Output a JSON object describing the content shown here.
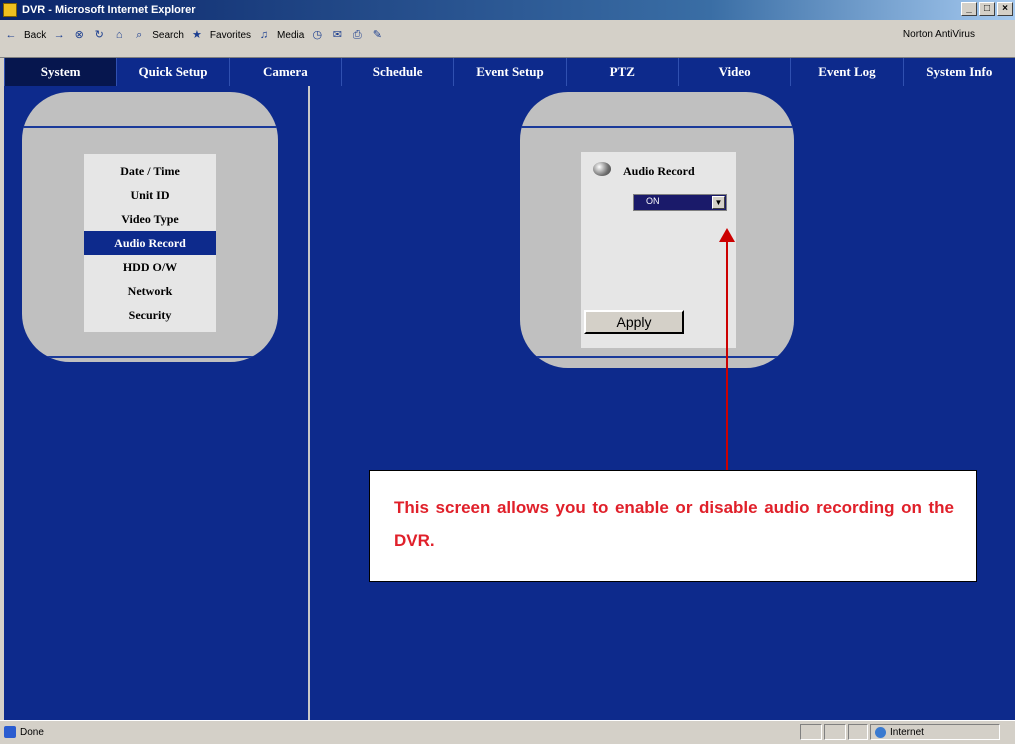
{
  "window": {
    "title": "DVR - Microsoft Internet Explorer"
  },
  "toolbar": {
    "back": "Back",
    "search": "Search",
    "favorites": "Favorites",
    "media": "Media",
    "right": "Norton AntiVirus"
  },
  "nav": {
    "tabs": [
      "System",
      "Quick Setup",
      "Camera",
      "Schedule",
      "Event Setup",
      "PTZ",
      "Video",
      "Event Log",
      "System Info"
    ]
  },
  "sidebar": {
    "items": [
      "Date / Time",
      "Unit ID",
      "Video Type",
      "Audio Record",
      "HDD O/W",
      "Network",
      "Security"
    ]
  },
  "panel": {
    "audio_label": "Audio Record",
    "select_value": "ON",
    "apply_label": "Apply"
  },
  "callout": {
    "text": "This screen allows you to enable or disable audio recording on the DVR."
  },
  "status": {
    "left": "Done",
    "zone": "Internet"
  },
  "colors": {
    "nav_bg": "#0d2a8c",
    "callout_text": "#e0202a",
    "selected": "#0d2a8c"
  }
}
